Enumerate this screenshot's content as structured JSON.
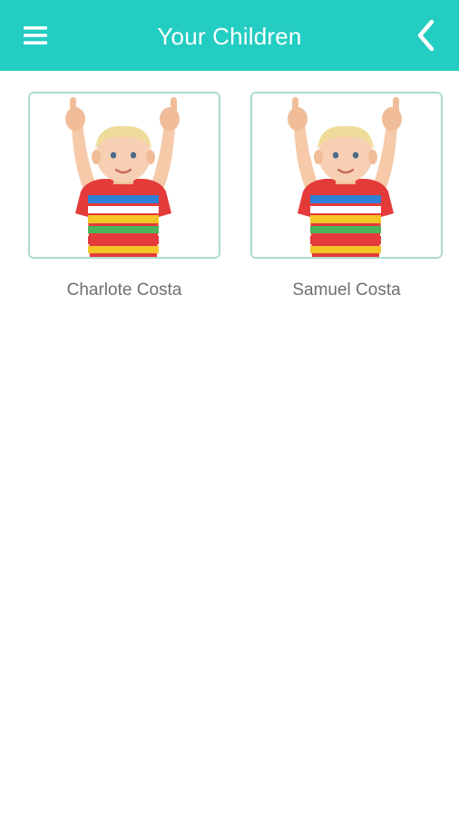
{
  "header": {
    "title": "Your Children",
    "menu_icon": "hamburger-menu-icon",
    "back_icon": "chevron-left-icon",
    "background_color": "#24cdc2"
  },
  "children": [
    {
      "name": "Charlote Costa",
      "photo": "child-thumbs-up-photo"
    },
    {
      "name": "Samuel Costa",
      "photo": "child-thumbs-up-photo"
    }
  ],
  "colors": {
    "accent": "#24cdc2",
    "card_border": "#a9dccd",
    "name_text": "#6f6f6f"
  }
}
